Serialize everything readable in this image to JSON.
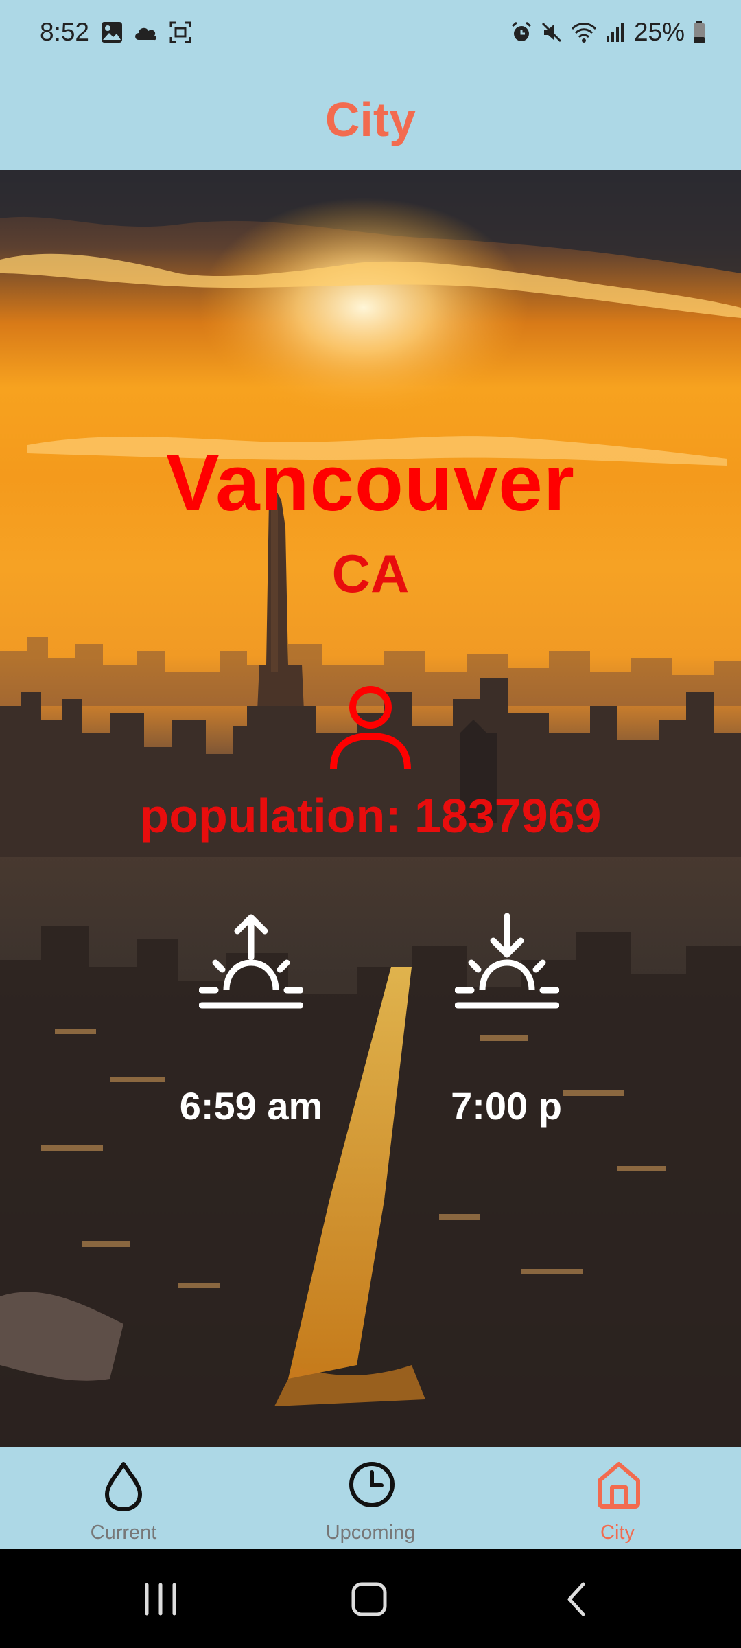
{
  "status_bar": {
    "time": "8:52",
    "battery": "25%",
    "left_icons": [
      "gallery-icon",
      "cloud-icon",
      "screenshot-icon"
    ],
    "right_icons": [
      "alarm-icon",
      "mute-icon",
      "wifi-icon",
      "signal-icon",
      "battery-icon"
    ]
  },
  "app_bar": {
    "title": "City"
  },
  "city": {
    "name": "Vancouver",
    "country": "CA",
    "population_text": "population: 1837969",
    "sunrise": "6:59 am",
    "sunset": "7:00 p"
  },
  "bottom_nav": {
    "items": [
      {
        "label": "Current",
        "icon": "drop-icon",
        "active": false
      },
      {
        "label": "Upcoming",
        "icon": "clock-icon",
        "active": false
      },
      {
        "label": "City",
        "icon": "home-icon",
        "active": true
      }
    ]
  },
  "colors": {
    "bar_background": "#add8e6",
    "accent": "#f26b4f",
    "city_text": "#ff0000",
    "time_text": "#ffffff"
  }
}
